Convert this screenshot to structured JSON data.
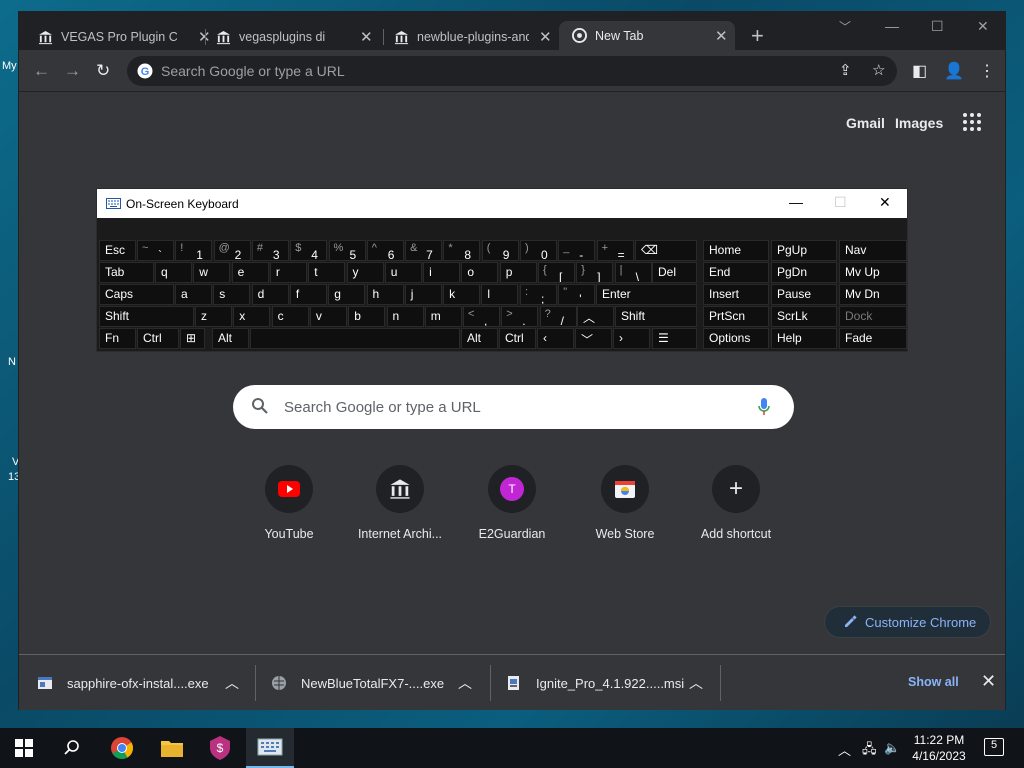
{
  "desktop": {
    "fragments": [
      "My",
      "N",
      "V",
      "13"
    ]
  },
  "browser": {
    "tabs": [
      {
        "title": "VEGAS Pro Plugin Co",
        "icon": "archive-icon"
      },
      {
        "title": "vegasplugins director",
        "icon": "archive-icon"
      },
      {
        "title": "newblue-plugins-and",
        "icon": "archive-icon"
      },
      {
        "title": "New Tab",
        "icon": "chrome-icon"
      }
    ],
    "new_tab_label": "+",
    "omnibox_placeholder": "Search Google or type a URL",
    "header_links": {
      "gmail": "Gmail",
      "images": "Images"
    },
    "search_placeholder": "Search Google or type a URL",
    "shortcuts": [
      {
        "label": "YouTube",
        "icon": "youtube-icon"
      },
      {
        "label": "Internet Archi...",
        "icon": "archive-icon"
      },
      {
        "label": "E2Guardian",
        "icon": "letter-t-icon",
        "letter": "T"
      },
      {
        "label": "Web Store",
        "icon": "webstore-icon"
      },
      {
        "label": "Add shortcut",
        "icon": "plus-icon"
      }
    ],
    "customize_label": "Customize Chrome",
    "downloads": [
      {
        "name": "sapphire-ofx-instal....exe"
      },
      {
        "name": "NewBlueTotalFX7-....exe"
      },
      {
        "name": "Ignite_Pro_4.1.922.....msi"
      }
    ],
    "show_all": "Show all"
  },
  "osk": {
    "title": "On-Screen Keyboard",
    "row1": {
      "esc": "Esc",
      "keys": [
        [
          "~",
          "`"
        ],
        [
          "!",
          "1"
        ],
        [
          "@",
          "2"
        ],
        [
          "#",
          "3"
        ],
        [
          "$",
          "4"
        ],
        [
          "%",
          "5"
        ],
        [
          "^",
          "6"
        ],
        [
          "&",
          "7"
        ],
        [
          "*",
          "8"
        ],
        [
          "(",
          "9"
        ],
        [
          ")",
          "0"
        ],
        [
          "_",
          "-"
        ],
        [
          "+",
          "="
        ]
      ]
    },
    "row2": {
      "tab": "Tab",
      "keys": [
        "q",
        "w",
        "e",
        "r",
        "t",
        "y",
        "u",
        "i",
        "o",
        "p"
      ],
      "brackets": [
        [
          "{",
          "["
        ],
        [
          "}",
          "]"
        ],
        [
          "|",
          "\\"
        ]
      ],
      "del": "Del"
    },
    "row3": {
      "caps": "Caps",
      "keys": [
        "a",
        "s",
        "d",
        "f",
        "g",
        "h",
        "j",
        "k",
        "l"
      ],
      "punct": [
        [
          ":",
          ";"
        ],
        [
          "\"",
          "'"
        ]
      ],
      "enter": "Enter"
    },
    "row4": {
      "shift": "Shift",
      "keys": [
        "z",
        "x",
        "c",
        "v",
        "b",
        "n",
        "m"
      ],
      "punct": [
        [
          "<",
          ","
        ],
        [
          ">",
          "."
        ],
        [
          "?",
          "/"
        ]
      ],
      "shift_r": "Shift"
    },
    "row5": {
      "fn": "Fn",
      "ctrl": "Ctrl",
      "alt": "Alt",
      "alt_r": "Alt",
      "ctrl_r": "Ctrl"
    },
    "nav": {
      "home": "Home",
      "pgup": "PgUp",
      "nav": "Nav",
      "end": "End",
      "pgdn": "PgDn",
      "mvup": "Mv Up",
      "insert": "Insert",
      "pause": "Pause",
      "mvdn": "Mv Dn",
      "prtscn": "PrtScn",
      "scrlk": "ScrLk",
      "dock": "Dock",
      "options": "Options",
      "help": "Help",
      "fade": "Fade"
    }
  },
  "taskbar": {
    "time": "11:22 PM",
    "date": "4/16/2023",
    "notifications": "5"
  }
}
